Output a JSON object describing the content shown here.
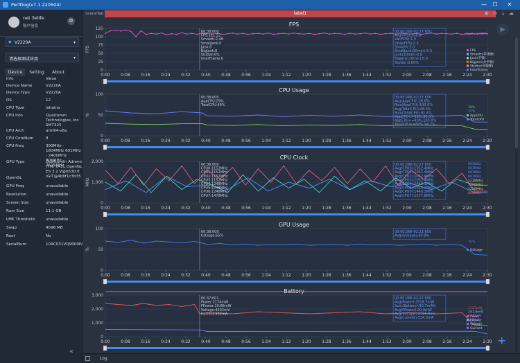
{
  "app": {
    "title": "PerfDog(v7.1.220504)",
    "min": "—",
    "max": "☐",
    "close": "✕"
  },
  "user": {
    "name": "net 3elife",
    "info": "账户信息",
    "settings_icon": "gear"
  },
  "device_select": {
    "value": "V2220A"
  },
  "app_select": {
    "placeholder": "请选择测试应用"
  },
  "tabs": [
    "Device",
    "Setting",
    "About"
  ],
  "table": {
    "header": {
      "k": "Info",
      "v": "Value"
    },
    "rows": [
      {
        "k": "Device Name",
        "v": "V2220A"
      },
      {
        "k": "Device Type",
        "v": "V2220A"
      },
      {
        "k": "OS",
        "v": "12"
      },
      {
        "k": "CPU Type",
        "v": "lahaina"
      },
      {
        "k": "CPU Info",
        "v": "Qualcomm Technologies, Inc SM7325"
      },
      {
        "k": "CPU Arch",
        "v": "arm64-v8a"
      },
      {
        "k": "CPU CoreNum",
        "v": "8"
      },
      {
        "k": "CPU Freq",
        "v": "300MHz - 1804MHz 691MHz - 2400MHz 806MHz - 2515MHz"
      },
      {
        "k": "GPU Type",
        "v": "Qualcomm Adreno (TM) 642L OpenGL ES 3.2 V@0530.0 (GIT@4b8f1c3b35"
      },
      {
        "k": "OpenGL",
        "v": ""
      },
      {
        "k": "GPU Freq",
        "v": "unavailable"
      },
      {
        "k": "Resolution",
        "v": "unavailable"
      },
      {
        "k": "Screen Size",
        "v": "unavailable"
      },
      {
        "k": "Ram Size",
        "v": "11.1 GB"
      },
      {
        "k": "LMK Threshold",
        "v": "unavailable"
      },
      {
        "k": "Swap",
        "v": "4096 MB"
      },
      {
        "k": "Root",
        "v": "No"
      },
      {
        "k": "SerialNum",
        "v": "10AC031VQ9000PA"
      }
    ]
  },
  "scene": {
    "tab": "SceneTab",
    "label": "label1"
  },
  "bottom": {
    "log": "Log"
  },
  "time_ticks": [
    "0:00",
    "0:08",
    "0:16",
    "0:24",
    "0:32",
    "0:40",
    "0:48",
    "0:56",
    "1:04",
    "1:12",
    "1:20",
    "1:28",
    "1:36",
    "1:44",
    "1:52",
    "2:00",
    "2:08",
    "2:16",
    "2:24",
    "2:30"
  ],
  "chart_data": [
    {
      "type": "line",
      "title": "FPS",
      "ylabel": "FPS",
      "yticks": [
        "0",
        "25",
        "50",
        "75",
        "100",
        "125"
      ],
      "ylim": [
        0,
        125
      ],
      "cursor_text": [
        "00:38:000",
        "FPS:111.22",
        "Smooth:2.48",
        "SmallJank:0",
        "Jank:0",
        "BigJank:0",
        "Stutter:0%",
        "InterFrame:0"
      ],
      "avg_text": [
        "00:00:266-02:27:650",
        "Avg(FPS):108.6",
        "Var(FPS):1.9",
        "Drop(FPS):2.3",
        "Smooth:3.0",
        "SmallJank(10min):4.3",
        "Jank(10min):0.0",
        "BigJank(10min):0.0",
        "Stutter:0.00%"
      ],
      "legend": [
        {
          "name": "FPS",
          "color": "#e052d0"
        },
        {
          "name": "Smooth(平滑度)",
          "color": "#5dc2ff"
        },
        {
          "name": "Jank(卡顿)",
          "color": "#d8d254"
        },
        {
          "name": "BigJank(大卡顿)",
          "color": "#ff6b4a"
        },
        {
          "name": "Stutter(卡顿率)",
          "color": "#ff9944"
        },
        {
          "name": "InterFrame",
          "color": "#4a78ff"
        }
      ],
      "series": [
        {
          "name": "FPS",
          "color": "#e052d0",
          "x": [
            0,
            2,
            4,
            6,
            8,
            10,
            12,
            14,
            16,
            18,
            20,
            22,
            24,
            26,
            28,
            30,
            32,
            34,
            36,
            38,
            40,
            42,
            44,
            46,
            48,
            50,
            52,
            54,
            56,
            58,
            60,
            62,
            64,
            66,
            68,
            70,
            72,
            74,
            76,
            78,
            80,
            82,
            84,
            86,
            88,
            90,
            92,
            94,
            96,
            98,
            100,
            102,
            104,
            106,
            108,
            110,
            112,
            114,
            116,
            118,
            120,
            122,
            124,
            126,
            128,
            130,
            132,
            134,
            136,
            138,
            140,
            142,
            144,
            146,
            148,
            150,
            141,
            142,
            143,
            144,
            145,
            146,
            147,
            148,
            149,
            150
          ],
          "y": [
            110,
            118,
            119,
            117,
            120,
            116,
            100,
            118,
            107,
            110,
            108,
            111,
            106,
            109,
            107,
            112,
            108,
            110,
            107,
            111,
            109,
            108,
            110,
            107,
            109,
            111,
            108,
            110,
            107,
            109,
            110,
            108,
            111,
            107,
            109,
            110,
            108,
            111,
            109,
            108,
            110,
            107,
            109,
            111,
            108,
            110,
            109,
            107,
            110,
            108,
            109,
            111,
            108,
            110,
            107,
            109,
            110,
            108,
            111,
            109,
            108,
            110,
            107,
            109,
            111,
            108,
            110,
            109,
            108,
            110,
            107,
            109,
            110,
            108,
            111,
            109,
            108,
            110,
            107,
            110,
            108,
            109,
            110,
            108,
            111,
            109
          ]
        }
      ]
    },
    {
      "type": "line",
      "title": "CPU Usage",
      "ylabel": "%",
      "yticks": [
        "0",
        "50",
        "100"
      ],
      "ylim": [
        0,
        100
      ],
      "cursor_text": [
        "00:38:000",
        "AppCPU:29%",
        "TotalCPU:49%"
      ],
      "avg_text": [
        "00:00:266-02:27:650",
        "Avg(AppCPU):26.6%",
        "Max(AppCPU):100.0%",
        "Avg(TotalCPU):48.3%",
        "Max(TotalCPU):91.8%",
        "AppCPU<=60%:99.3%",
        "AppCPU<=80%:100.0%",
        "TotalCPU<=60%:94.7%"
      ],
      "legend": [
        {
          "name": "AppCPU",
          "color": "#7cd35a"
        },
        {
          "name": "TotalCPU",
          "color": "#6b7cff"
        }
      ],
      "right_labels": [
        {
          "text": "16%",
          "color": "#7cd35a"
        },
        {
          "text": "33%",
          "color": "#6b7cff"
        }
      ],
      "series": [
        {
          "name": "TotalCPU",
          "color": "#6b7cff",
          "x": [
            0,
            10,
            20,
            30,
            38,
            40,
            50,
            60,
            70,
            80,
            90,
            100,
            110,
            120,
            130,
            140,
            145,
            150
          ],
          "y": [
            60,
            55,
            53,
            58,
            55,
            48,
            47,
            50,
            46,
            49,
            47,
            50,
            46,
            48,
            47,
            49,
            33,
            33
          ]
        },
        {
          "name": "AppCPU",
          "color": "#7cd35a",
          "x": [
            0,
            10,
            20,
            30,
            38,
            40,
            50,
            60,
            70,
            80,
            90,
            100,
            110,
            120,
            130,
            140,
            145,
            150
          ],
          "y": [
            30,
            28,
            27,
            29,
            29,
            26,
            25,
            27,
            24,
            26,
            25,
            27,
            24,
            26,
            25,
            24,
            16,
            16
          ]
        }
      ]
    },
    {
      "type": "line",
      "title": "CPU Clock",
      "ylabel": "MHz",
      "yticks": [
        "0",
        "1,000",
        "2,000"
      ],
      "ylim": [
        0,
        2800
      ],
      "cursor_text": [
        "00:38:000",
        "CPU0:1152MHz",
        "CPU1:1152MHz",
        "CPU2:1152MHz",
        "CPU3:1152MHz",
        "CPU4:1248MHz",
        "CPU5:1248MHz",
        "CPU6:1248MHz",
        "CPU7:1478MHz"
      ],
      "avg_text": [
        "00:00:266-02:27:650",
        "Avg(CPU0):1052.4MHz",
        "Avg(CPU1):1052.4MHz",
        "Avg(CPU2):1052.4MHz",
        "Avg(CPU3):1052.4MHz",
        "Avg(CPU4):1440.1MHz",
        "Avg(CPU5):1440.1MHz",
        "Avg(CPU6):1440.1MHz",
        "Avg(CPU7):1577.6MHz"
      ],
      "right_labels": [
        {
          "text": "691MHz",
          "color": "#5a8cff"
        },
        {
          "text": "691MHz",
          "color": "#5a8cff"
        },
        {
          "text": "691MHz",
          "color": "#5a8cff"
        },
        {
          "text": "691MHz",
          "color": "#5a8cff"
        },
        {
          "text": "1228MHz",
          "color": "#d8d254"
        },
        {
          "text": "1228MHz",
          "color": "#d8d254"
        },
        {
          "text": "1228MHz",
          "color": "#d8d254"
        },
        {
          "text": "806MHz",
          "color": "#ff6b4a"
        }
      ],
      "series": [
        {
          "name": "CPU0",
          "color": "#5a8cff",
          "x": [
            0,
            8,
            16,
            24,
            32,
            40,
            48,
            56,
            64,
            72,
            80,
            88,
            96,
            104,
            112,
            120,
            128,
            136,
            145,
            150
          ],
          "y": [
            900,
            1500,
            700,
            1800,
            1100,
            1200,
            900,
            1700,
            800,
            1400,
            1000,
            1600,
            900,
            1500,
            1100,
            1300,
            900,
            1400,
            700,
            700
          ]
        },
        {
          "name": "CPU4",
          "color": "#3fd0c8",
          "x": [
            0,
            6,
            12,
            18,
            24,
            30,
            36,
            42,
            48,
            54,
            60,
            66,
            72,
            78,
            84,
            90,
            96,
            102,
            108,
            114,
            120,
            126,
            132,
            138,
            145,
            150
          ],
          "y": [
            1400,
            800,
            1900,
            700,
            1800,
            900,
            1600,
            1200,
            700,
            1900,
            800,
            1700,
            1000,
            1600,
            700,
            1800,
            900,
            1500,
            800,
            1700,
            1000,
            1400,
            800,
            1600,
            1200,
            1200
          ]
        },
        {
          "name": "CPU7",
          "color": "#e0607a",
          "x": [
            0,
            5,
            10,
            15,
            20,
            25,
            30,
            35,
            40,
            45,
            50,
            55,
            60,
            65,
            70,
            75,
            80,
            85,
            90,
            95,
            100,
            105,
            110,
            115,
            120,
            125,
            130,
            135,
            140,
            145,
            150
          ],
          "y": [
            2200,
            1300,
            2400,
            1200,
            2300,
            1500,
            2500,
            1300,
            2200,
            1600,
            2400,
            1200,
            2300,
            1400,
            2500,
            1300,
            2200,
            1500,
            2400,
            1300,
            2300,
            1400,
            2500,
            1200,
            2200,
            1600,
            2300,
            1300,
            2000,
            800,
            800
          ]
        }
      ]
    },
    {
      "type": "line",
      "title": "GPU Usage",
      "ylabel": "%",
      "yticks": [
        "0",
        "50",
        "100"
      ],
      "ylim": [
        0,
        100
      ],
      "cursor_text": [
        "00:38:000",
        "GUsage:65%"
      ],
      "avg_text": [
        "00:00:266-02:22:650",
        "Avg(GUsage):60.9%"
      ],
      "legend": [
        {
          "name": "GUsage",
          "color": "#4a78ff"
        }
      ],
      "right_labels": [
        {
          "text": "36%",
          "color": "#4a78ff"
        }
      ],
      "series": [
        {
          "name": "GUsage",
          "color": "#4a78ff",
          "x": [
            0,
            5,
            10,
            15,
            20,
            25,
            30,
            35,
            38,
            40,
            45,
            50,
            55,
            60,
            65,
            70,
            75,
            80,
            85,
            90,
            95,
            100,
            105,
            110,
            115,
            120,
            125,
            130,
            135,
            140,
            145,
            150
          ],
          "y": [
            70,
            67,
            72,
            65,
            70,
            68,
            66,
            69,
            65,
            62,
            64,
            61,
            63,
            60,
            62,
            61,
            63,
            60,
            61,
            62,
            60,
            63,
            61,
            62,
            60,
            61,
            63,
            60,
            62,
            60,
            38,
            36
          ]
        }
      ]
    },
    {
      "type": "line",
      "title": "Battery",
      "ylabel": "",
      "yticks": [
        "0",
        "1,000",
        "2,000",
        "3,000"
      ],
      "ylim": [
        0,
        4000
      ],
      "cursor_text": [
        "00:37:601",
        "Power:2174mW",
        "FPower:19.86mW",
        "Voltage:4332mV",
        "Current:502mA"
      ],
      "avg_text": [
        "00:00:266-02:27:650",
        "Avg(Power):2518.7mW",
        "Sum(Battery):90.7mWh",
        "Avg(FPower):20.0mW",
        "Avg(Voltage):4326.8mV",
        "Avg(Current):514.3mA"
      ],
      "legend": [
        {
          "name": "Power",
          "color": "#e05a5a"
        },
        {
          "name": "FPower",
          "color": "#5dc2ff"
        },
        {
          "name": "Voltage",
          "color": "#d05ae0"
        },
        {
          "name": "Current",
          "color": "#6b7cff"
        }
      ],
      "right_labels": [
        {
          "text": "1127mW",
          "color": "#e05a5a"
        },
        {
          "text": "19.18mW",
          "color": "#5dc2ff"
        },
        {
          "text": "4332mV",
          "color": "#d05ae0"
        },
        {
          "text": "260mA",
          "color": "#6b7cff"
        }
      ],
      "series": [
        {
          "name": "Power",
          "color": "#e05a5a",
          "x": [
            0,
            5,
            10,
            15,
            20,
            25,
            30,
            35,
            37,
            40,
            50,
            60,
            70,
            80,
            90,
            100,
            110,
            120,
            130,
            140,
            145,
            150
          ],
          "y": [
            3200,
            3100,
            3000,
            3200,
            3000,
            3100,
            2900,
            3100,
            2200,
            2300,
            2200,
            2400,
            2300,
            2200,
            2300,
            2400,
            2200,
            2300,
            2200,
            2300,
            1100,
            1100
          ]
        },
        {
          "name": "Voltage",
          "color": "#d05ae0",
          "x": [
            0,
            150
          ],
          "y": [
            4330,
            4330
          ]
        },
        {
          "name": "Current",
          "color": "#6b7cff",
          "x": [
            0,
            37,
            40,
            145,
            150
          ],
          "y": [
            700,
            650,
            500,
            520,
            260
          ]
        }
      ]
    }
  ]
}
